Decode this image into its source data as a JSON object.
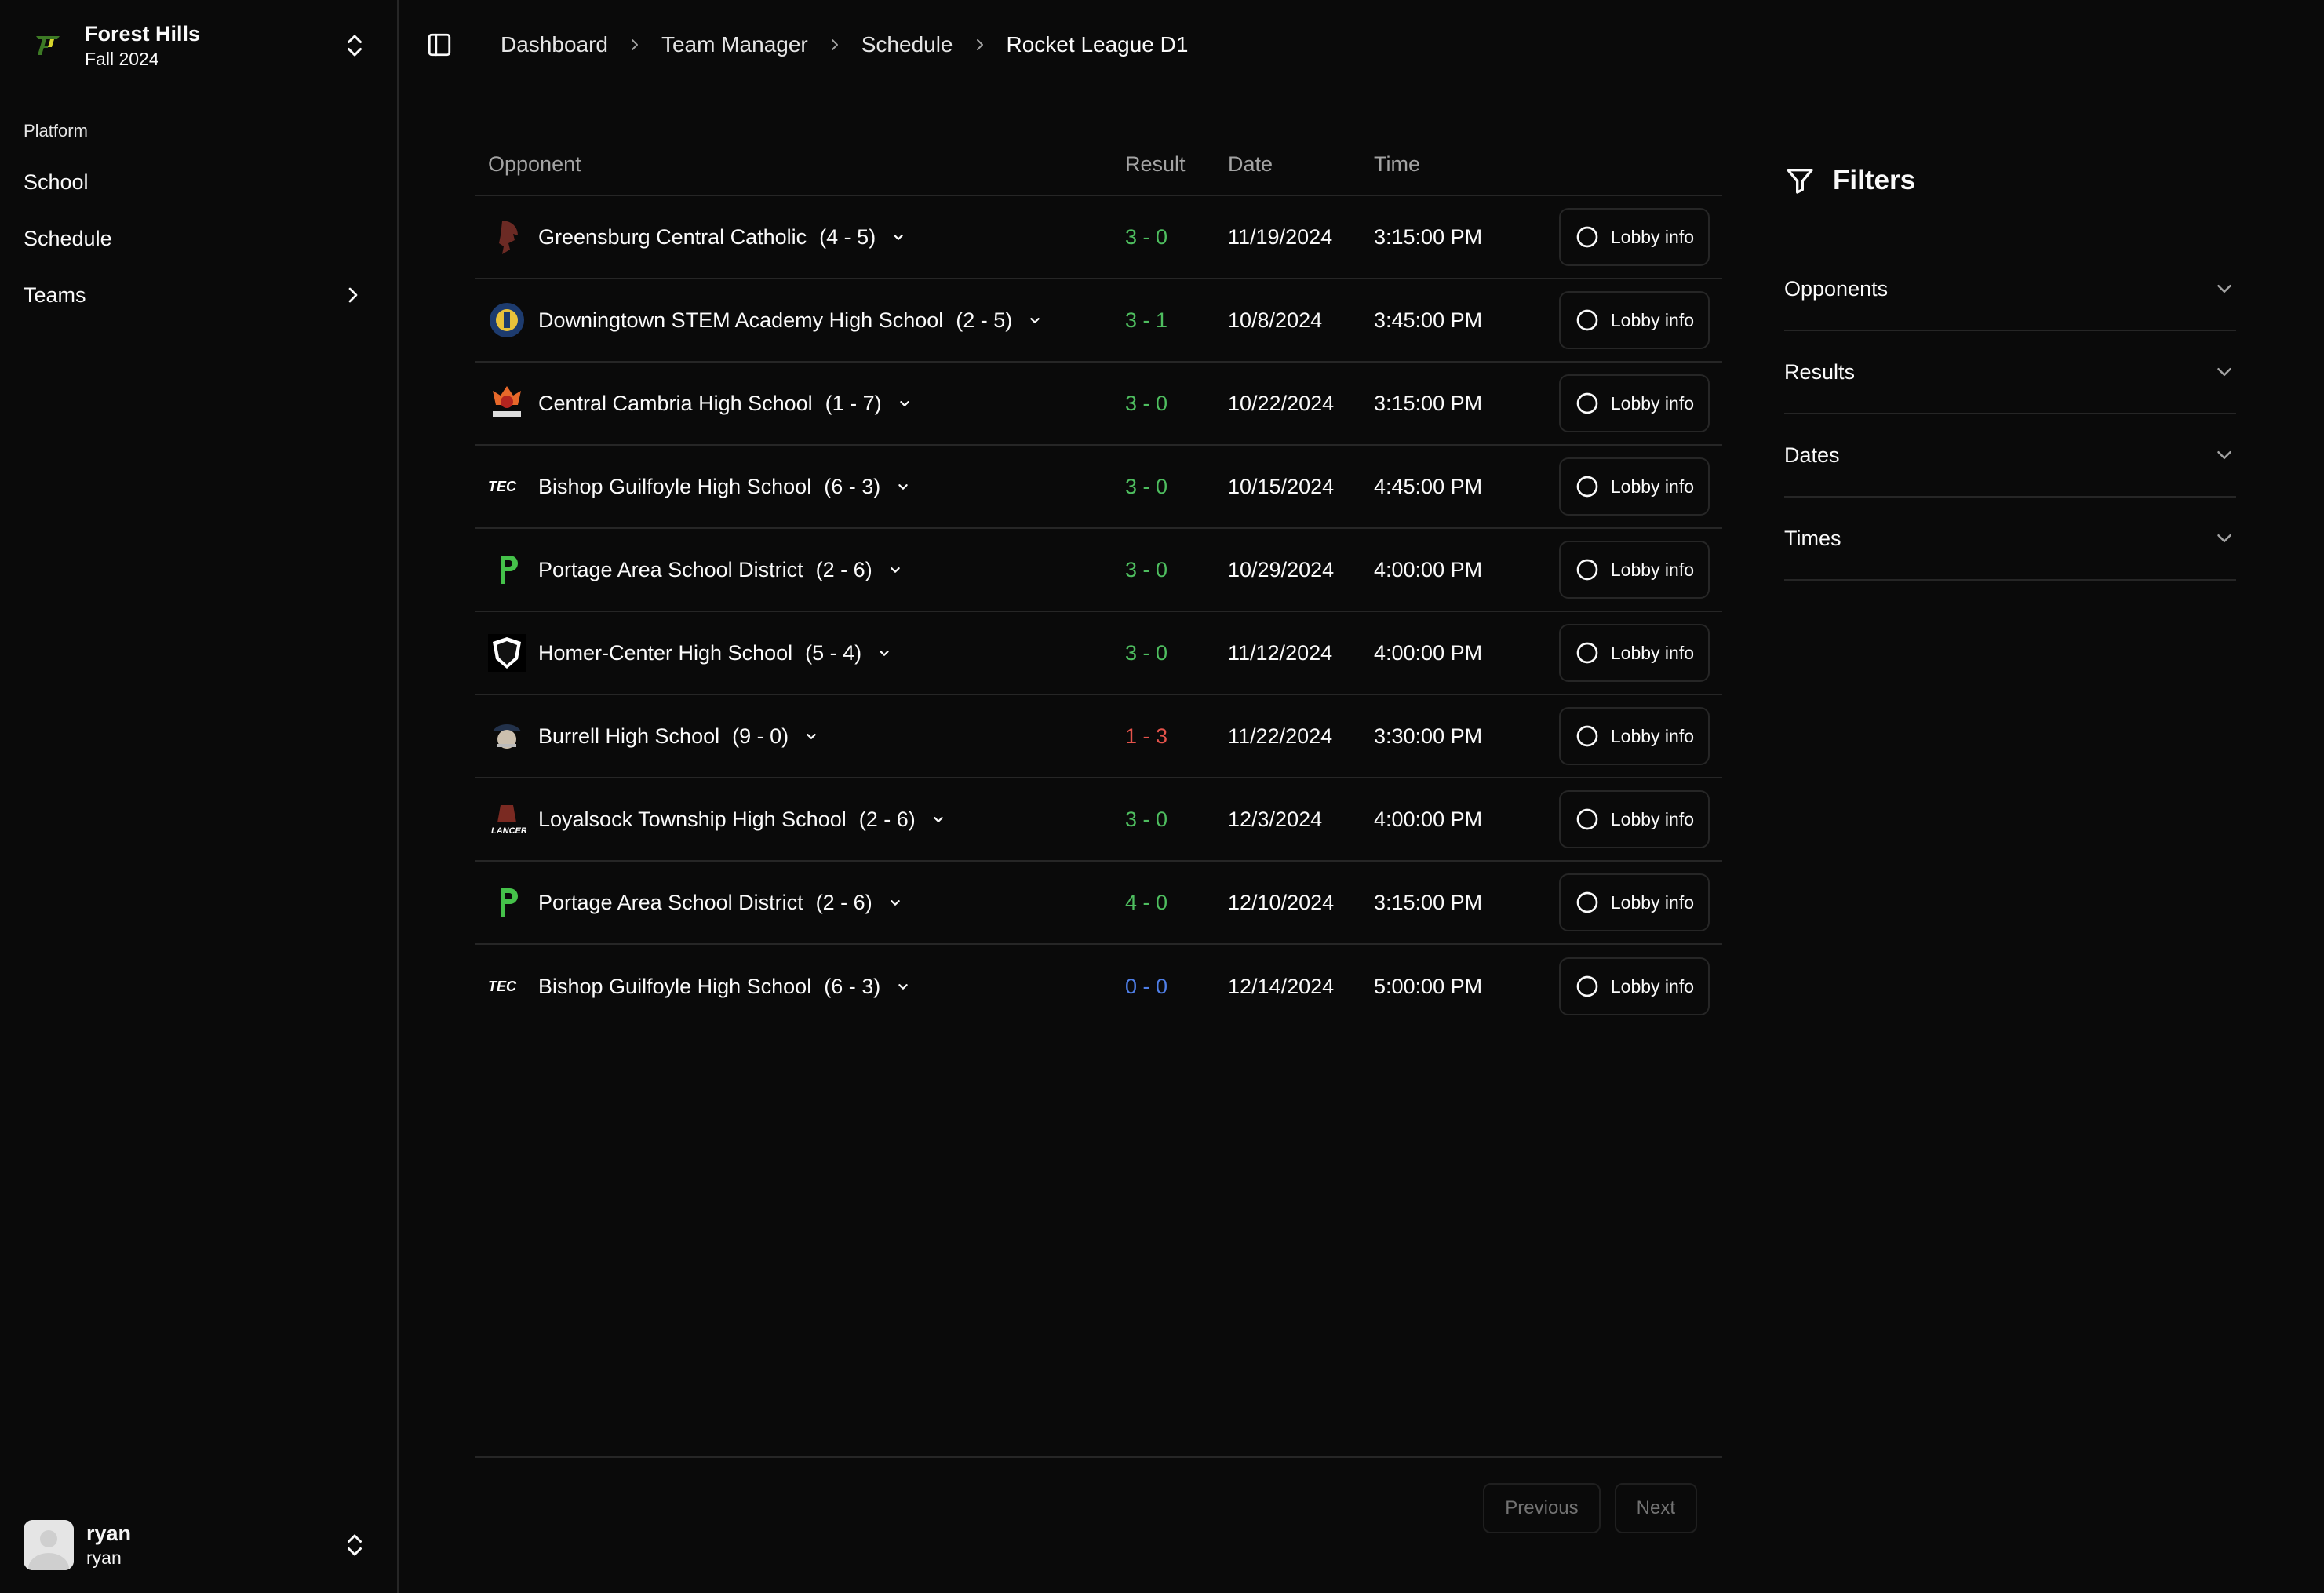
{
  "sidebar": {
    "team_name": "Forest Hills",
    "team_season": "Fall 2024",
    "group_label": "Platform",
    "items": [
      {
        "label": "School"
      },
      {
        "label": "Schedule"
      },
      {
        "label": "Teams"
      }
    ],
    "user": {
      "name": "ryan",
      "handle": "ryan"
    }
  },
  "breadcrumb": [
    "Dashboard",
    "Team Manager",
    "Schedule",
    "Rocket League D1"
  ],
  "table": {
    "headers": {
      "opponent": "Opponent",
      "result": "Result",
      "date": "Date",
      "time": "Time"
    },
    "action_label": "Lobby info",
    "rows": [
      {
        "opponent": "Greensburg Central Catholic",
        "record": "(4 - 5)",
        "logo": "spartan-logo",
        "result": "3 - 0",
        "status": "win",
        "date": "11/19/2024",
        "time": "3:15:00 PM"
      },
      {
        "opponent": "Downingtown STEM Academy High School",
        "record": "(2 - 5)",
        "logo": "stem-academy-logo",
        "result": "3 - 1",
        "status": "win",
        "date": "10/8/2024",
        "time": "3:45:00 PM"
      },
      {
        "opponent": "Central Cambria High School",
        "record": "(1 - 7)",
        "logo": "inferno-logo",
        "result": "3 - 0",
        "status": "win",
        "date": "10/22/2024",
        "time": "3:15:00 PM"
      },
      {
        "opponent": "Bishop Guilfoyle High School",
        "record": "(6 - 3)",
        "logo": "tec-logo",
        "result": "3 - 0",
        "status": "win",
        "date": "10/15/2024",
        "time": "4:45:00 PM"
      },
      {
        "opponent": "Portage Area School District",
        "record": "(2 - 6)",
        "logo": "portage-p-logo",
        "result": "3 - 0",
        "status": "win",
        "date": "10/29/2024",
        "time": "4:00:00 PM"
      },
      {
        "opponent": "Homer-Center High School",
        "record": "(5 - 4)",
        "logo": "wildcat-shield-logo",
        "result": "3 - 0",
        "status": "win",
        "date": "11/12/2024",
        "time": "4:00:00 PM"
      },
      {
        "opponent": "Burrell High School",
        "record": "(9 - 0)",
        "logo": "pirate-logo",
        "result": "1 - 3",
        "status": "loss",
        "date": "11/22/2024",
        "time": "3:30:00 PM"
      },
      {
        "opponent": "Loyalsock Township High School",
        "record": "(2 - 6)",
        "logo": "lancers-logo",
        "result": "3 - 0",
        "status": "win",
        "date": "12/3/2024",
        "time": "4:00:00 PM"
      },
      {
        "opponent": "Portage Area School District",
        "record": "(2 - 6)",
        "logo": "portage-p-logo",
        "result": "4 - 0",
        "status": "win",
        "date": "12/10/2024",
        "time": "3:15:00 PM"
      },
      {
        "opponent": "Bishop Guilfoyle High School",
        "record": "(6 - 3)",
        "logo": "tec-logo",
        "result": "0 - 0",
        "status": "pending",
        "date": "12/14/2024",
        "time": "5:00:00 PM"
      }
    ]
  },
  "pagination": {
    "previous": "Previous",
    "next": "Next"
  },
  "filters": {
    "title": "Filters",
    "items": [
      {
        "label": "Opponents"
      },
      {
        "label": "Results"
      },
      {
        "label": "Dates"
      },
      {
        "label": "Times"
      }
    ]
  },
  "colors": {
    "win": "#4ebe5f",
    "loss": "#e5534b",
    "pending": "#4f7fe8",
    "background": "#0a0a0a",
    "border": "#262626"
  }
}
